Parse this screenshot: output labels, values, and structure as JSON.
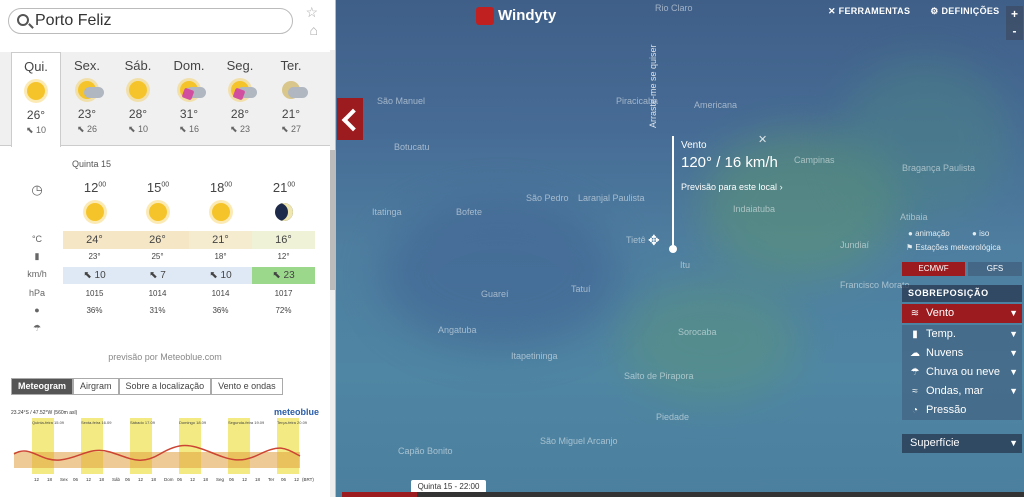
{
  "app": {
    "name": "Windyty"
  },
  "search": {
    "value": "Porto Feliz",
    "placeholder": ""
  },
  "days": [
    {
      "name": "Qui.",
      "temp": "26°",
      "wind": "10",
      "icon": "sun-icon"
    },
    {
      "name": "Sex.",
      "temp": "23°",
      "wind": "26",
      "icon": "sun-cloud-icon"
    },
    {
      "name": "Sáb.",
      "temp": "28°",
      "wind": "10",
      "icon": "sun-icon"
    },
    {
      "name": "Dom.",
      "temp": "31°",
      "wind": "16",
      "icon": "storm-icon"
    },
    {
      "name": "Seg.",
      "temp": "28°",
      "wind": "23",
      "icon": "storm-icon"
    },
    {
      "name": "Ter.",
      "temp": "21°",
      "wind": "27",
      "icon": "cloud-icon"
    }
  ],
  "detail": {
    "title": "Quinta 15",
    "hours": [
      {
        "h": "12",
        "m": "00"
      },
      {
        "h": "15",
        "m": "00"
      },
      {
        "h": "18",
        "m": "00"
      },
      {
        "h": "21",
        "m": "00"
      }
    ],
    "labels": {
      "temp": "°C",
      "wind": "km/h",
      "pressure": "hPa"
    },
    "temps": [
      "24°",
      "26°",
      "21°",
      "16°"
    ],
    "dew": [
      "23°",
      "25°",
      "18°",
      "12°"
    ],
    "winds": [
      "10",
      "7",
      "10",
      "23"
    ],
    "pressures": [
      "1015",
      "1014",
      "1014",
      "1017"
    ],
    "humidity": [
      "36%",
      "31%",
      "36%",
      "72%"
    ]
  },
  "attribution": "previsão por Meteoblue.com",
  "tabs": [
    "Meteogram",
    "Airgram",
    "Sobre a localização",
    "Vento e ondas"
  ],
  "meteogram": {
    "brand": "meteoblue",
    "coords": "23.24°S / 47.52°W (560m asl)",
    "days": [
      "Quinta-feira 15.09",
      "Sexta-feira 16.09",
      "Sábado 17.09",
      "Domingo 18.09",
      "Segunda-feira 19.09",
      "Terça-feira 20.09"
    ],
    "ticks": [
      "12",
      "18",
      "Sex",
      "06",
      "12",
      "18",
      "Sáb",
      "06",
      "12",
      "18",
      "Dom",
      "06",
      "12",
      "18",
      "Seg",
      "06",
      "12",
      "18",
      "Ter",
      "06",
      "12"
    ],
    "tz": "(BRT)"
  },
  "map": {
    "toplinks": {
      "tools": "FERRAMENTAS",
      "settings": "DEFINIÇÕES"
    },
    "zoom_in": "+",
    "zoom_out": "-",
    "popup": {
      "title": "Vento",
      "value": "120° / 16 km/h",
      "link": "Previsão para este local"
    },
    "drag_hint": "Arraste-me se quiser",
    "places": [
      "Rio Claro",
      "São Manuel",
      "Botucatu",
      "Piracicaba",
      "Americana",
      "Campinas",
      "Bragança Paulista",
      "Itatinga",
      "Bofete",
      "São Pedro",
      "Laranjal Paulista",
      "Indaiatuba",
      "Atibaia",
      "Tietê",
      "Tatuí",
      "Itu",
      "Jundiaí",
      "Guareí",
      "Sorocaba",
      "Francisco Morato",
      "Angatuba",
      "Itapetininga",
      "Salto de Pirapora",
      "Piedade",
      "Capão Bonito",
      "São Miguel Arcanjo"
    ],
    "timebox": "Quinta 15 - 22:00",
    "timeline_progress": 0.11
  },
  "right": {
    "animation": "animação",
    "isolines": "iso",
    "stations": "Estações meteorológica",
    "models": [
      "ECMWF",
      "GFS"
    ],
    "overlay_header": "SOBREPOSIÇÃO",
    "overlays": [
      {
        "label": "Vento",
        "icon": "wind-icon"
      },
      {
        "label": "Temp.",
        "icon": "thermometer-icon"
      },
      {
        "label": "Nuvens",
        "icon": "cloud-icon"
      },
      {
        "label": "Chuva ou neve",
        "icon": "rain-icon"
      },
      {
        "label": "Ondas, mar",
        "icon": "waves-icon"
      },
      {
        "label": "Pressão",
        "icon": "gauge-icon"
      }
    ],
    "surface": "Superfície"
  }
}
